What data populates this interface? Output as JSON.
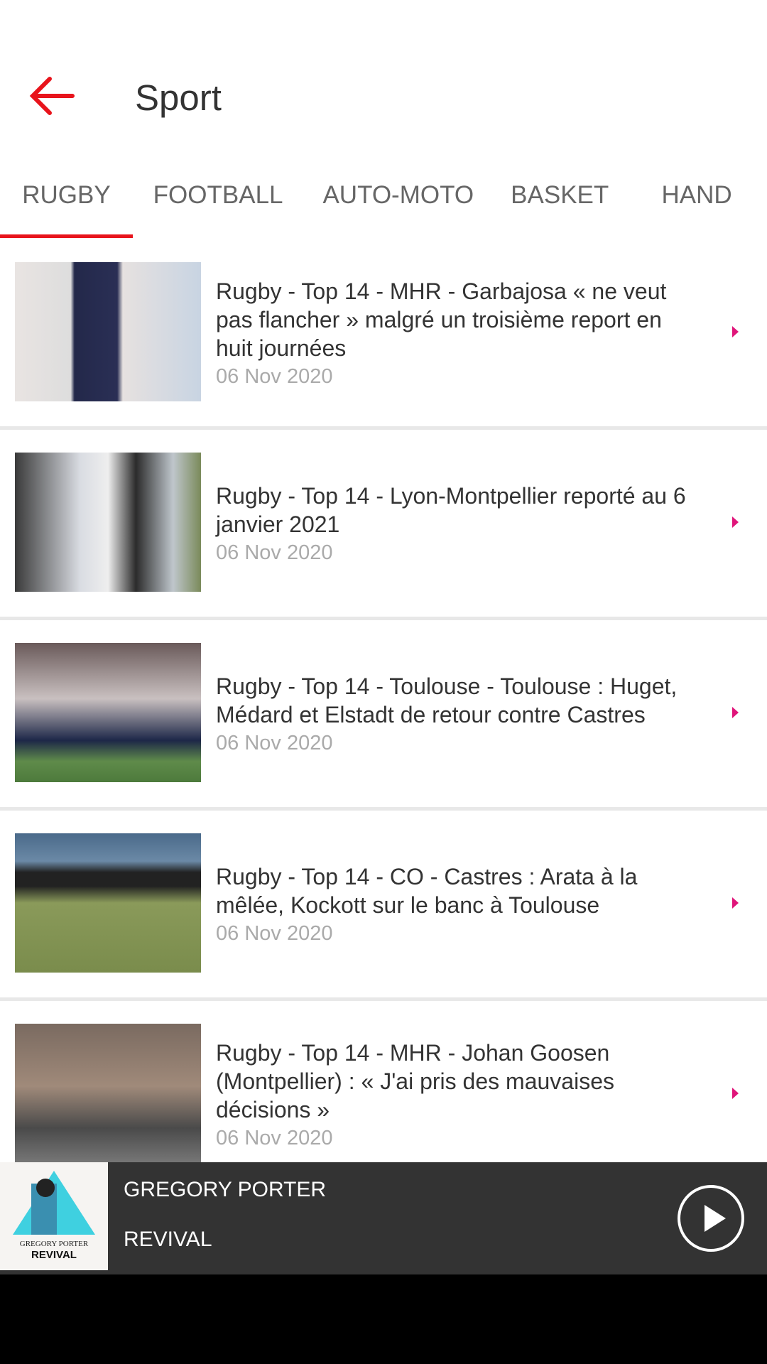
{
  "header": {
    "title": "Sport",
    "back_icon": "arrow-left-icon",
    "accent": "#e8141c"
  },
  "tabs": [
    {
      "label": "RUGBY",
      "active": true
    },
    {
      "label": "FOOTBALL"
    },
    {
      "label": "AUTO-MOTO"
    },
    {
      "label": "BASKET"
    },
    {
      "label": "HAND"
    }
  ],
  "articles": [
    {
      "title": "Rugby - Top 14 - MHR - Garbajosa « ne veut pas flancher » malgré un troisième report en huit journées",
      "date": "06 Nov 2020"
    },
    {
      "title": "Rugby - Top 14 - Lyon-Montpellier reporté au 6 janvier 2021",
      "date": "06 Nov 2020"
    },
    {
      "title": "Rugby - Top 14 - Toulouse - Toulouse : Huget, Médard et Elstadt de retour contre Castres",
      "date": "06 Nov 2020"
    },
    {
      "title": "Rugby - Top 14 - CO - Castres : Arata à la mêlée, Kockott sur le banc à Toulouse",
      "date": "06 Nov 2020"
    },
    {
      "title": "Rugby - Top 14 - MHR - Johan Goosen (Montpellier) : « J'ai pris des mauvaises décisions »",
      "date": "06 Nov 2020"
    }
  ],
  "player": {
    "artist": "GREGORY PORTER",
    "album": "REVIVAL",
    "art_text": "GREGORY PORTER REVIVAL",
    "play_icon": "play-circle-icon"
  }
}
